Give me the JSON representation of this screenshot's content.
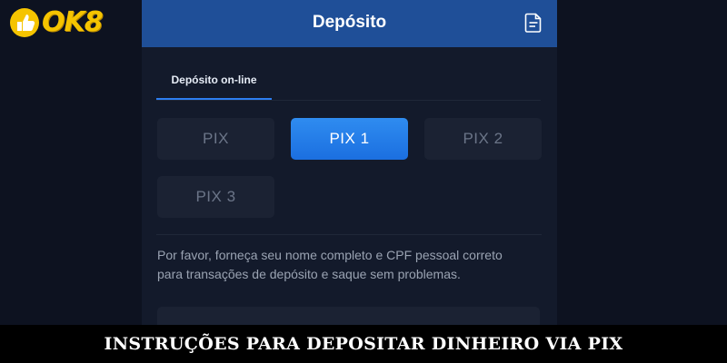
{
  "logo": {
    "text": "OK8",
    "icon": "thumbs-up-icon",
    "color": "#f5c400"
  },
  "header": {
    "title": "Depósito",
    "icon": "document-icon",
    "background": "#1f4f98"
  },
  "tabs": [
    {
      "label": "Depósito on-line",
      "active": true
    }
  ],
  "pix_options": [
    {
      "label": "PIX",
      "active": false
    },
    {
      "label": "PIX 1",
      "active": true
    },
    {
      "label": "PIX 2",
      "active": false
    },
    {
      "label": "PIX 3",
      "active": false
    }
  ],
  "notice": {
    "text": "Por favor, forneça seu nome completo e CPF pessoal correto para transações de depósito e saque sem problemas."
  },
  "caption": {
    "text": "INSTRUÇÕES PARA DEPOSITAR DINHEIRO VIA PIX"
  },
  "colors": {
    "accent": "#2d7ef0",
    "active_button": "#1b6fe0",
    "panel": "#131a2b",
    "page_background": "#0d1220"
  }
}
